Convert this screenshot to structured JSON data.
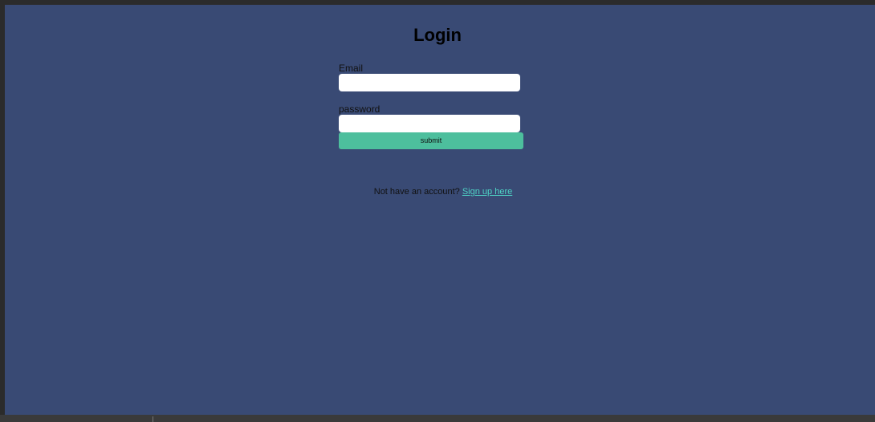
{
  "login": {
    "title": "Login",
    "email_label": "Email",
    "email_value": "",
    "password_label": "password",
    "password_value": "",
    "submit_label": "submit",
    "signup_prompt": "Not have an account?",
    "signup_link": "Sign up here"
  },
  "theme": {
    "page_background": "#394a74",
    "button_color": "#4dbf9d",
    "link_color": "#4fd4c6"
  }
}
